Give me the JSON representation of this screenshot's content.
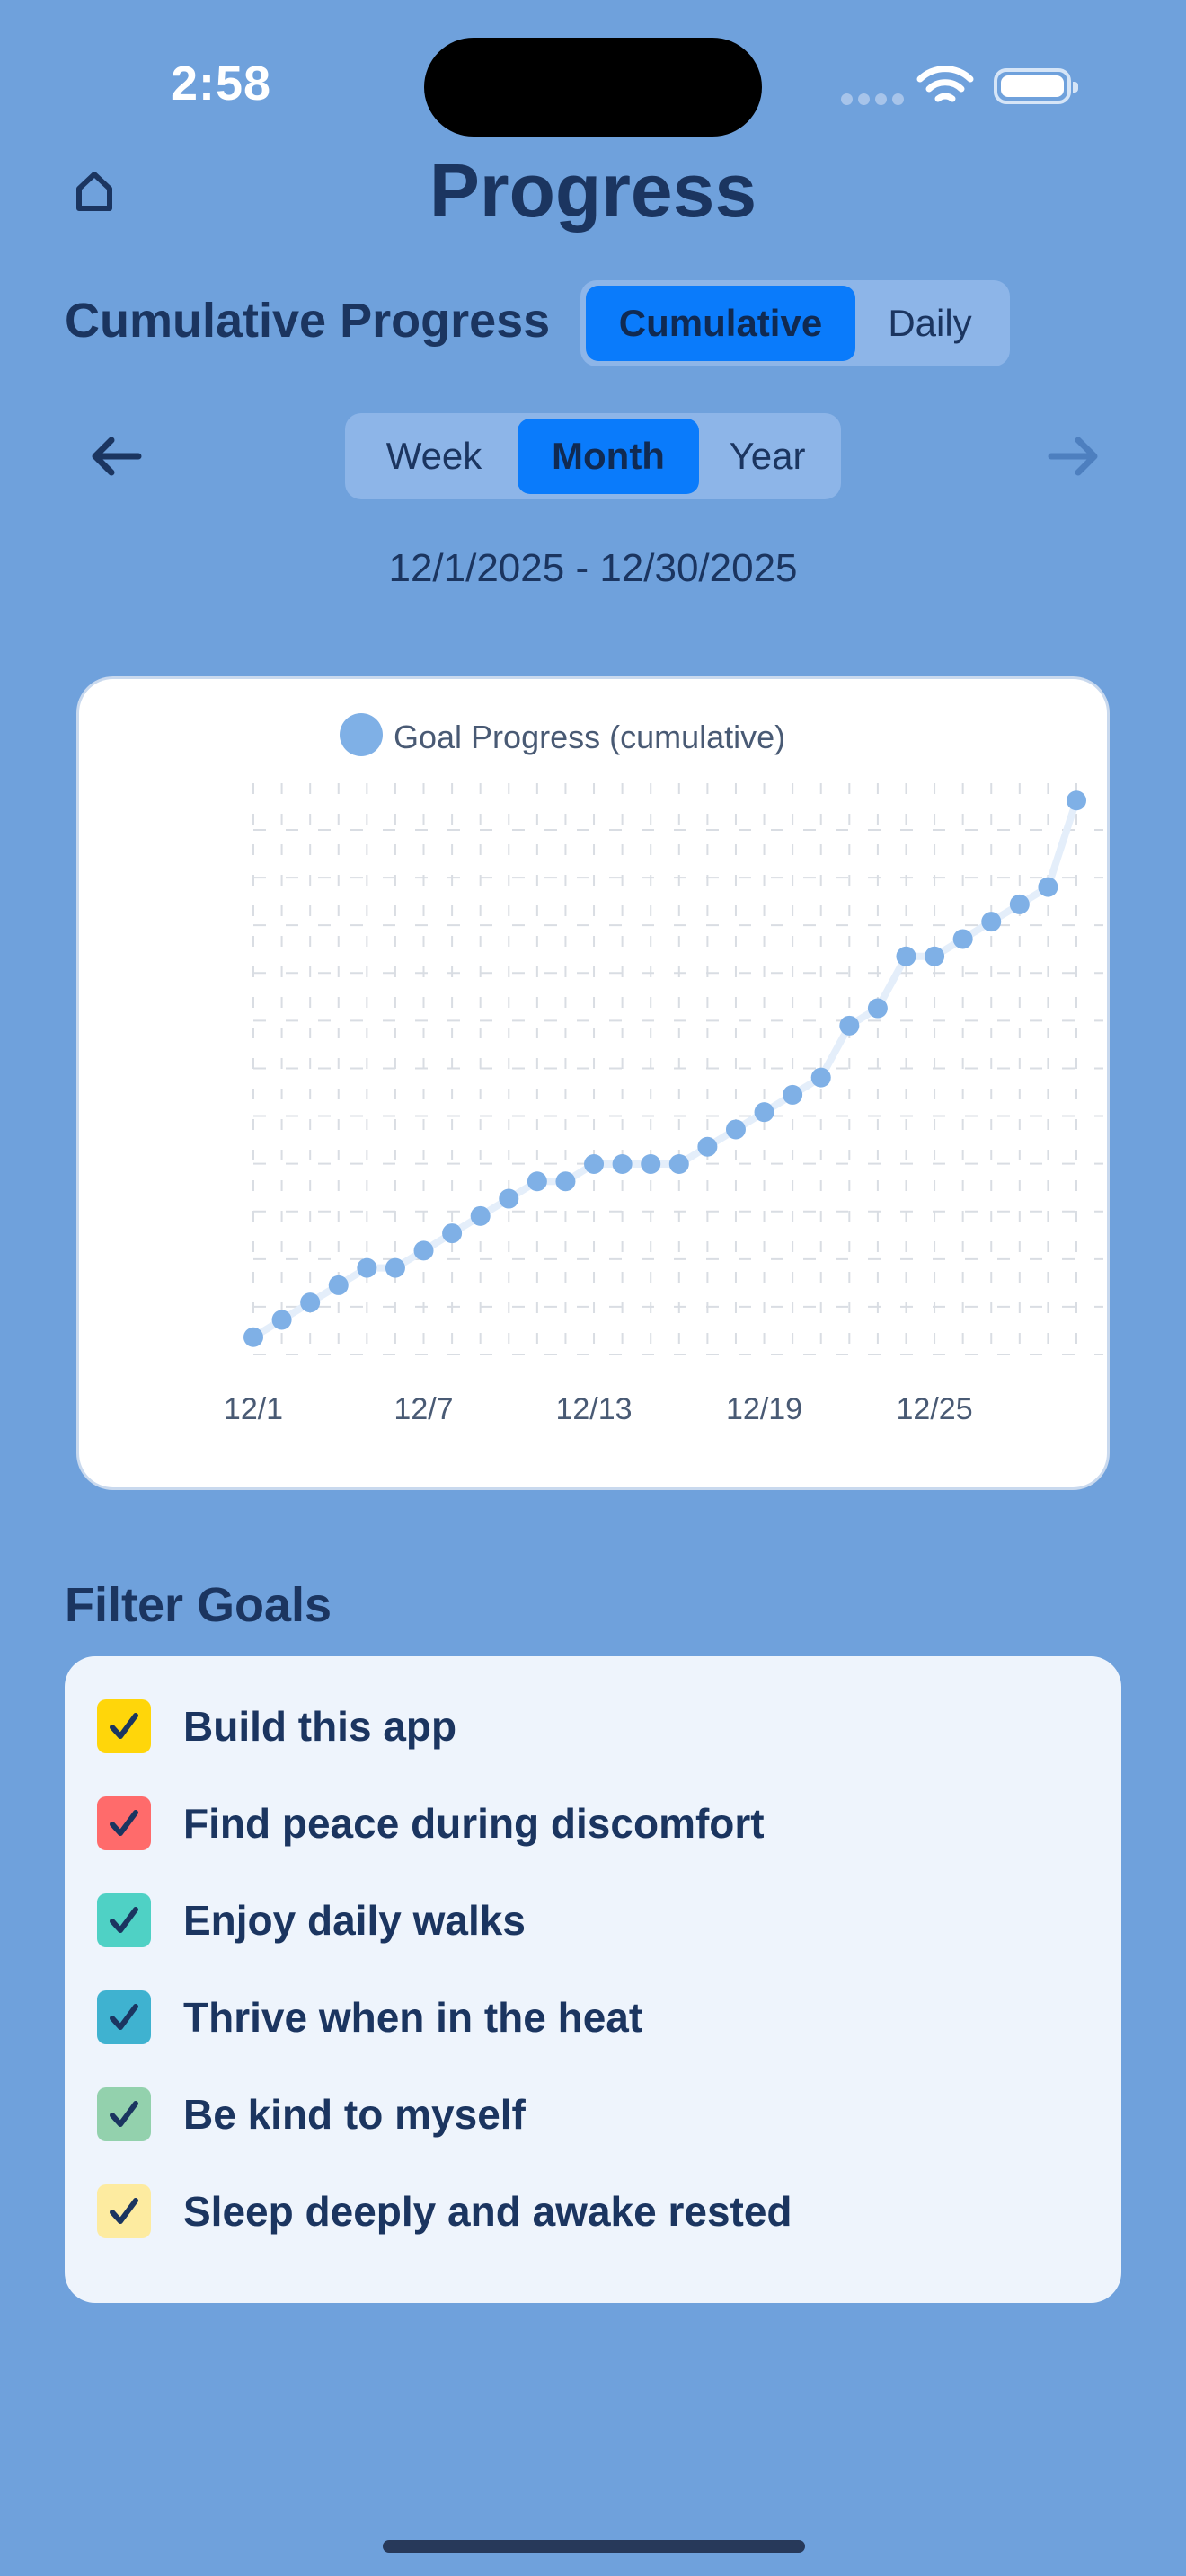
{
  "status_bar": {
    "time": "2:58"
  },
  "header": {
    "title": "Progress",
    "home_icon": "home-icon"
  },
  "section": {
    "title": "Cumulative Progress"
  },
  "mode_toggle": {
    "options": [
      "Cumulative",
      "Daily"
    ],
    "selected": "Cumulative"
  },
  "range_toggle": {
    "options": [
      "Week",
      "Month",
      "Year"
    ],
    "selected": "Month"
  },
  "nav": {
    "prev_icon": "arrow-left-icon",
    "next_icon": "arrow-right-icon"
  },
  "date_range": "12/1/2025 - 12/30/2025",
  "colors": {
    "background": "#6fa1dc",
    "accent": "#0a7bfb",
    "point": "#7fb0e6"
  },
  "chart_data": {
    "type": "line",
    "legend": "Goal Progress (cumulative)",
    "x_ticks": [
      "12/1",
      "12/7",
      "12/13",
      "12/19",
      "12/25"
    ],
    "series": [
      {
        "name": "Goal Progress (cumulative)",
        "x": [
          "12/1",
          "12/2",
          "12/3",
          "12/4",
          "12/5",
          "12/6",
          "12/7",
          "12/8",
          "12/9",
          "12/10",
          "12/11",
          "12/12",
          "12/13",
          "12/14",
          "12/15",
          "12/16",
          "12/17",
          "12/18",
          "12/19",
          "12/20",
          "12/21",
          "12/22",
          "12/23",
          "12/24",
          "12/25",
          "12/26",
          "12/27",
          "12/28",
          "12/29",
          "12/30"
        ],
        "values": [
          1,
          2,
          3,
          4,
          5,
          5,
          6,
          7,
          8,
          9,
          10,
          10,
          11,
          11,
          11,
          11,
          12,
          13,
          14,
          15,
          16,
          19,
          20,
          23,
          23,
          24,
          25,
          26,
          27,
          32
        ]
      }
    ],
    "ylim": [
      0,
      33
    ],
    "grid": true
  },
  "filter": {
    "title": "Filter Goals",
    "goals": [
      {
        "label": "Build this app",
        "color": "#ffd60a",
        "checked": true
      },
      {
        "label": "Find peace during discomfort",
        "color": "#ff6b6b",
        "checked": true
      },
      {
        "label": "Enjoy daily walks",
        "color": "#4fd1c5",
        "checked": true
      },
      {
        "label": "Thrive when in the heat",
        "color": "#3fb2d0",
        "checked": true
      },
      {
        "label": "Be kind to myself",
        "color": "#93d1ad",
        "checked": true
      },
      {
        "label": "Sleep deeply and awake rested",
        "color": "#fdeba0",
        "checked": true
      }
    ]
  }
}
